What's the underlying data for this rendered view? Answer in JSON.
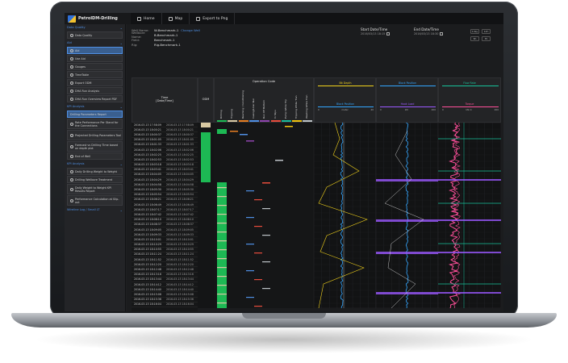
{
  "app": {
    "title": "PetrolDM-Drilling"
  },
  "nav": {
    "home": "Home",
    "map": "Map",
    "export": "Export to Png"
  },
  "sidebar": {
    "sections": [
      {
        "title": "Data Quality",
        "items": [
          {
            "label": "Data Quality"
          }
        ]
      },
      {
        "title": "Aid",
        "items": [
          {
            "label": "Aid"
          },
          {
            "label": "Use Aid"
          },
          {
            "label": "Gauges"
          },
          {
            "label": "TimeTable"
          },
          {
            "label": "Export ODM"
          },
          {
            "label": "DHA Run Analysis"
          },
          {
            "label": "DHA Run Overview Report PDF"
          }
        ]
      },
      {
        "title": "KPI Analysis",
        "items": [
          {
            "label": "Drilling Parameters Report"
          },
          {
            "label": "Rate Performance Per Stand for the Connections"
          },
          {
            "label": "Projected Drilling Parameters Tool"
          },
          {
            "label": "Forecast vs Drilling Time based on depth plot"
          },
          {
            "label": "End of Well"
          }
        ]
      },
      {
        "title": "KPI Analysis",
        "items": [
          {
            "label": "Daily Drilling Weight to Weight"
          },
          {
            "label": "Drilling Wellbore Treatment"
          },
          {
            "label": "Daily Weight to Weight KPI Results Report"
          },
          {
            "label": "Performance Calculation at Slip-out"
          }
        ]
      },
      {
        "title": "Wireline Log / Small LT",
        "items": []
      }
    ]
  },
  "well_info": {
    "well_label": "Well Name:",
    "well_value": "W-Benchmark-1",
    "change_label": "Change Well",
    "wellbore_label": "Wellbore Name:",
    "wellbore_value": "B-Benchmark-1",
    "field_label": "Field:",
    "field_value": "Benchmark-1",
    "rig_label": "Rig:",
    "rig_value": "Rig-Benchmark-1"
  },
  "dates": {
    "start_title": "Start Date/Time",
    "start_value": "2016/03/13 18:15",
    "end_title": "End Date/Time",
    "end_value": "2016/03/13 18:30"
  },
  "time_buttons": [
    "1day",
    "12h",
    "6h",
    "3h"
  ],
  "table": {
    "time_header": "Time\n[Date/Time]",
    "odm_header": "ODM",
    "operation_header": "Operation Code",
    "operation_codes": [
      "Drilling",
      "Tripping",
      "Reaming / Conditioning",
      "Casing/Liner Run",
      "Run Off Bottom",
      "In Slips",
      "Pump While Trip",
      "Tripping While Tran",
      "Washing While Tran"
    ],
    "tracks": [
      {
        "top": "Bit Depth",
        "top_range": [
          "0",
          "meter",
          "40"
        ],
        "bottom": "Block Position",
        "bottom_range": [
          "0",
          "meter",
          "40"
        ]
      },
      {
        "top": "Block Position",
        "top_range": [
          "0",
          "meter",
          "200"
        ],
        "bottom": "Hook Load",
        "bottom_range": [
          "0",
          "kN",
          "200"
        ]
      },
      {
        "top": "Flow Rate",
        "top_range": [
          "0",
          "L/min",
          "200"
        ],
        "bottom": "Torque",
        "bottom_range": [
          "0",
          "kN·m",
          "200"
        ]
      }
    ],
    "rows": [
      [
        "2016-03-13 17:58:09",
        "2016-03-13 17:58:09"
      ],
      [
        "2016-03-13 18:00:21",
        "2016-03-13 18:00:21"
      ],
      [
        "2016-03-13 18:00:37",
        "2016-03-13 18:00:37"
      ],
      [
        "2016-03-13 18:01:05",
        "2016-03-13 18:01:05"
      ],
      [
        "2016-03-13 18:01:33",
        "2016-03-13 18:01:33"
      ],
      [
        "2016-03-13 18:02:06",
        "2016-03-13 18:02:06"
      ],
      [
        "2016-03-13 18:02:25",
        "2016-03-13 18:02:25"
      ],
      [
        "2016-03-13 18:02:53",
        "2016-03-13 18:02:53"
      ],
      [
        "2016-03-13 18:03:18",
        "2016-03-13 18:03:18"
      ],
      [
        "2016-03-13 18:03:41",
        "2016-03-13 18:03:41"
      ],
      [
        "2016-03-13 18:04:05",
        "2016-03-13 18:04:05"
      ],
      [
        "2016-03-13 18:04:29",
        "2016-03-13 18:04:29"
      ],
      [
        "2016-03-13 18:04:58",
        "2016-03-13 18:04:58"
      ],
      [
        "2016-03-13 18:05:30",
        "2016-03-13 18:05:30"
      ],
      [
        "2016-03-13 18:05:54",
        "2016-03-13 18:05:54"
      ],
      [
        "2016-03-13 18:06:21",
        "2016-03-13 18:06:21"
      ],
      [
        "2016-03-13 18:06:49",
        "2016-03-13 18:06:49"
      ],
      [
        "2016-03-13 18:07:17",
        "2016-03-13 18:07:17"
      ],
      [
        "2016-03-13 18:07:42",
        "2016-03-13 18:07:42"
      ],
      [
        "2016-03-13 18:08:10",
        "2016-03-13 18:08:10"
      ],
      [
        "2016-03-13 18:08:37",
        "2016-03-13 18:08:37"
      ],
      [
        "2016-03-13 18:09:05",
        "2016-03-13 18:09:05"
      ],
      [
        "2016-03-13 18:09:33",
        "2016-03-13 18:09:33"
      ],
      [
        "2016-03-13 18:10:01",
        "2016-03-13 18:10:01"
      ],
      [
        "2016-03-13 18:10:29",
        "2016-03-13 18:10:29"
      ],
      [
        "2016-03-13 18:10:55",
        "2016-03-13 18:10:55"
      ],
      [
        "2016-03-13 18:11:24",
        "2016-03-13 18:11:24"
      ],
      [
        "2016-03-13 18:11:52",
        "2016-03-13 18:11:52"
      ],
      [
        "2016-03-13 18:12:20",
        "2016-03-13 18:12:20"
      ],
      [
        "2016-03-13 18:12:48",
        "2016-03-13 18:12:48"
      ],
      [
        "2016-03-13 18:13:16",
        "2016-03-13 18:13:16"
      ],
      [
        "2016-03-13 18:13:44",
        "2016-03-13 18:13:44"
      ],
      [
        "2016-03-13 18:14:12",
        "2016-03-13 18:14:12"
      ],
      [
        "2016-03-13 18:14:40",
        "2016-03-13 18:14:40"
      ],
      [
        "2016-03-13 18:15:08",
        "2016-03-13 18:15:08"
      ],
      [
        "2016-03-13 18:15:36",
        "2016-03-13 18:15:36"
      ],
      [
        "2016-03-13 18:16:04",
        "2016-03-13 18:16:04"
      ]
    ]
  },
  "colors": {
    "accent": "#4f8fe3",
    "bit_depth": "#f2d21b",
    "block_position": "#33a6ff",
    "hook_load": "#9b59ff",
    "flow_rate": "#17c29a",
    "torque": "#ff4f9a",
    "odm_green": "#1db954",
    "odm_tan": "#d8c9a3"
  }
}
